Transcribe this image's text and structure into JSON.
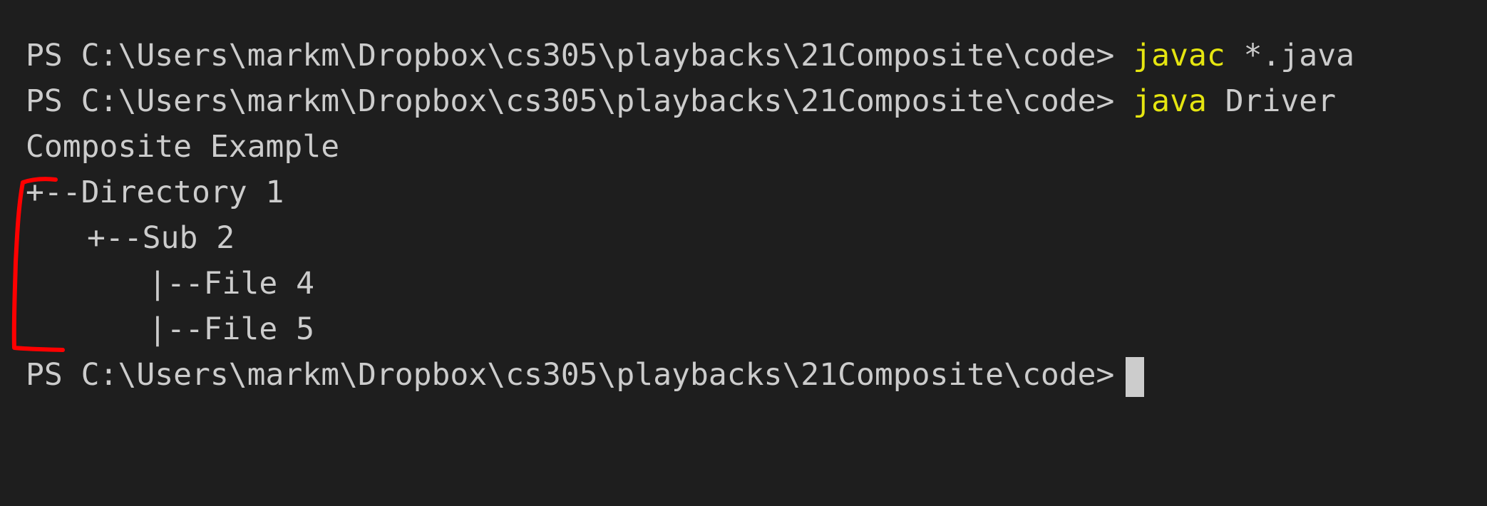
{
  "terminal": {
    "prompt": "PS C:\\Users\\markm\\Dropbox\\cs305\\playbacks\\21Composite\\code>",
    "commands": [
      {
        "keyword": "javac",
        "args": " *.java"
      },
      {
        "keyword": "java",
        "args": " Driver"
      }
    ],
    "output": {
      "title": "Composite Example",
      "tree": {
        "root": "+--Directory 1",
        "sub": "+--Sub 2",
        "files": [
          "|--File 4",
          "|--File 5"
        ]
      }
    }
  },
  "colors": {
    "background": "#1e1e1e",
    "text": "#cccccc",
    "command_keyword": "#e5e510",
    "annotation": "#ff0000"
  }
}
